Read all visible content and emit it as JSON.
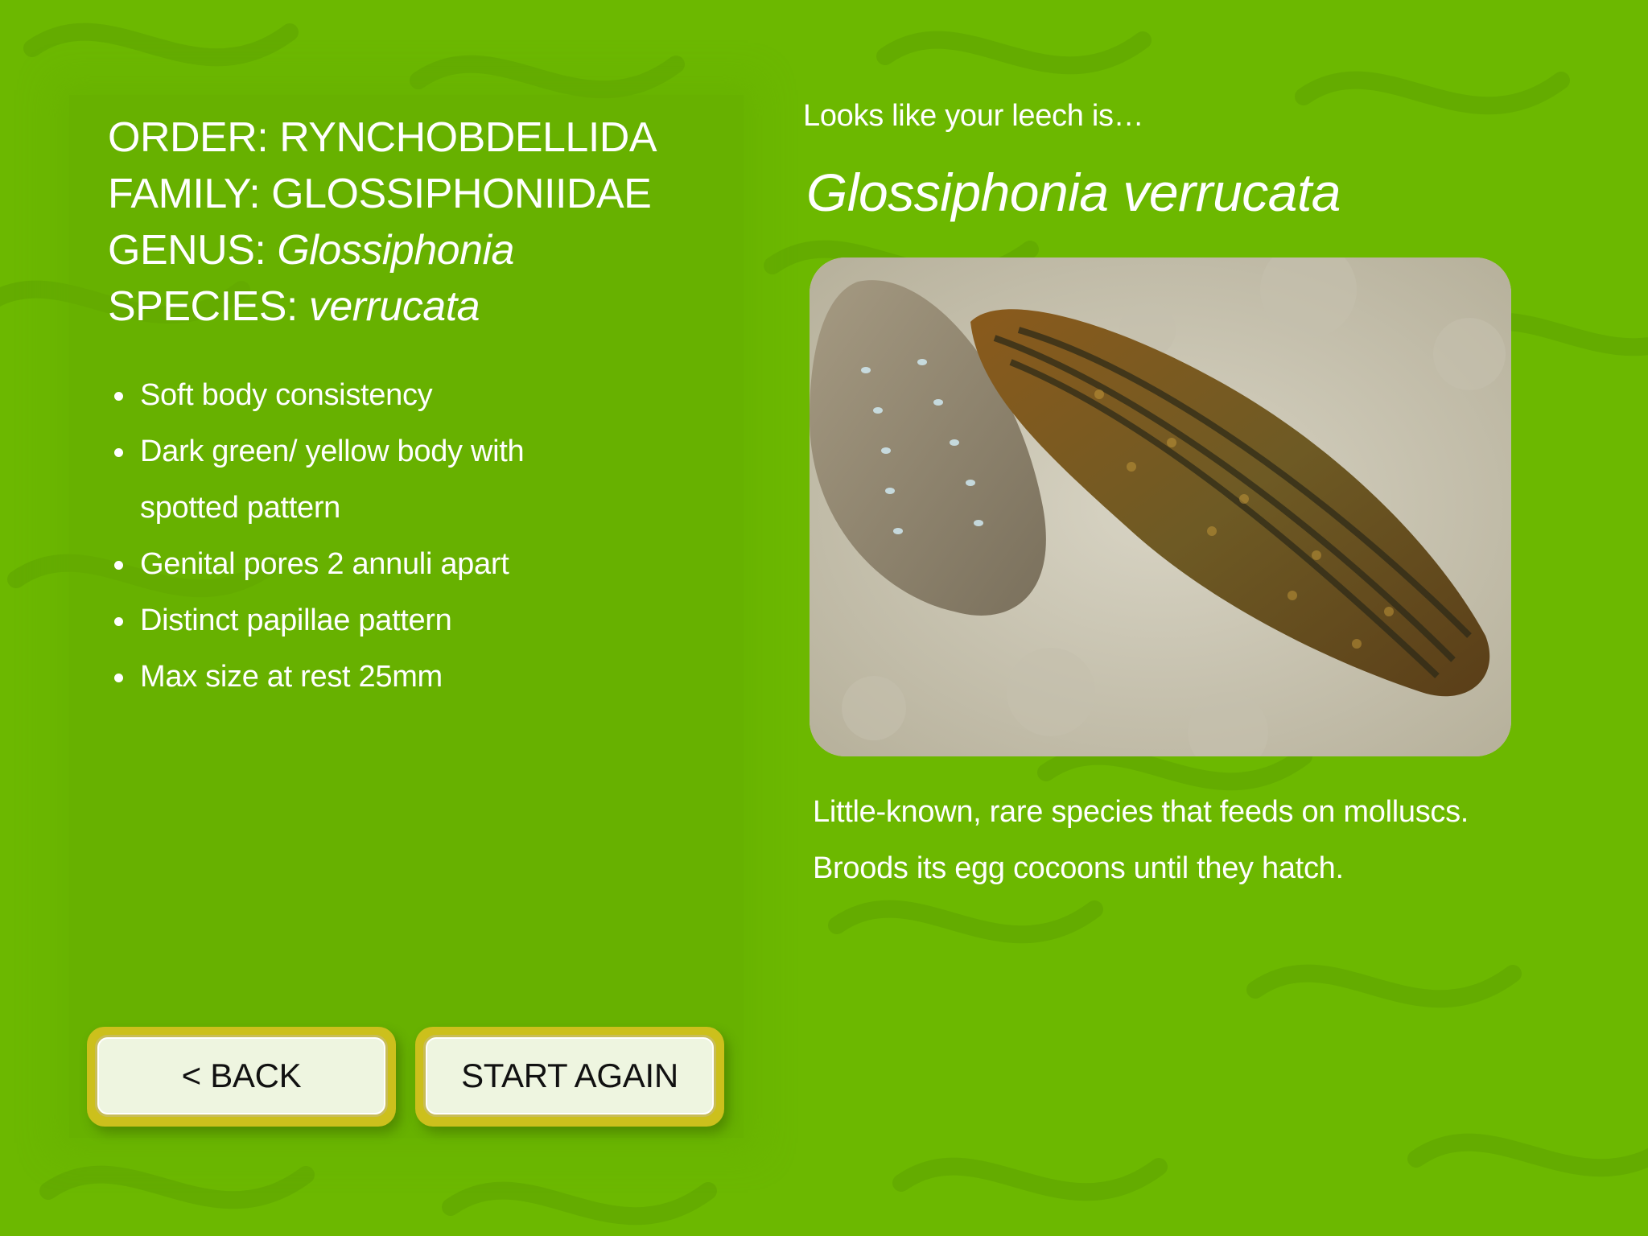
{
  "taxonomy": {
    "order_label": "ORDER: ",
    "order_value": "RYNCHOBDELLIDA",
    "family_label": "FAMILY: ",
    "family_value": "GLOSSIPHONIIDAE",
    "genus_label": "GENUS: ",
    "genus_value": "Glossiphonia",
    "species_label": "SPECIES: ",
    "species_value": "verrucata"
  },
  "features": [
    "Soft body consistency",
    "Dark green/ yellow body with spotted pattern",
    "Genital pores 2 annuli apart",
    "Distinct papillae pattern",
    "Max size at rest 25mm"
  ],
  "result": {
    "intro": "Looks like your leech is…",
    "species_name": "Glossiphonia verrucata"
  },
  "description": [
    "Little-known, rare species that feeds on molluscs.",
    "Broods its egg cocoons until they hatch."
  ],
  "buttons": {
    "back": "< BACK",
    "start_again": "START AGAIN"
  },
  "colors": {
    "background": "#6cb800",
    "text": "#ffffff",
    "button_face": "#eef5e0",
    "button_frame": "#ccc01c"
  }
}
